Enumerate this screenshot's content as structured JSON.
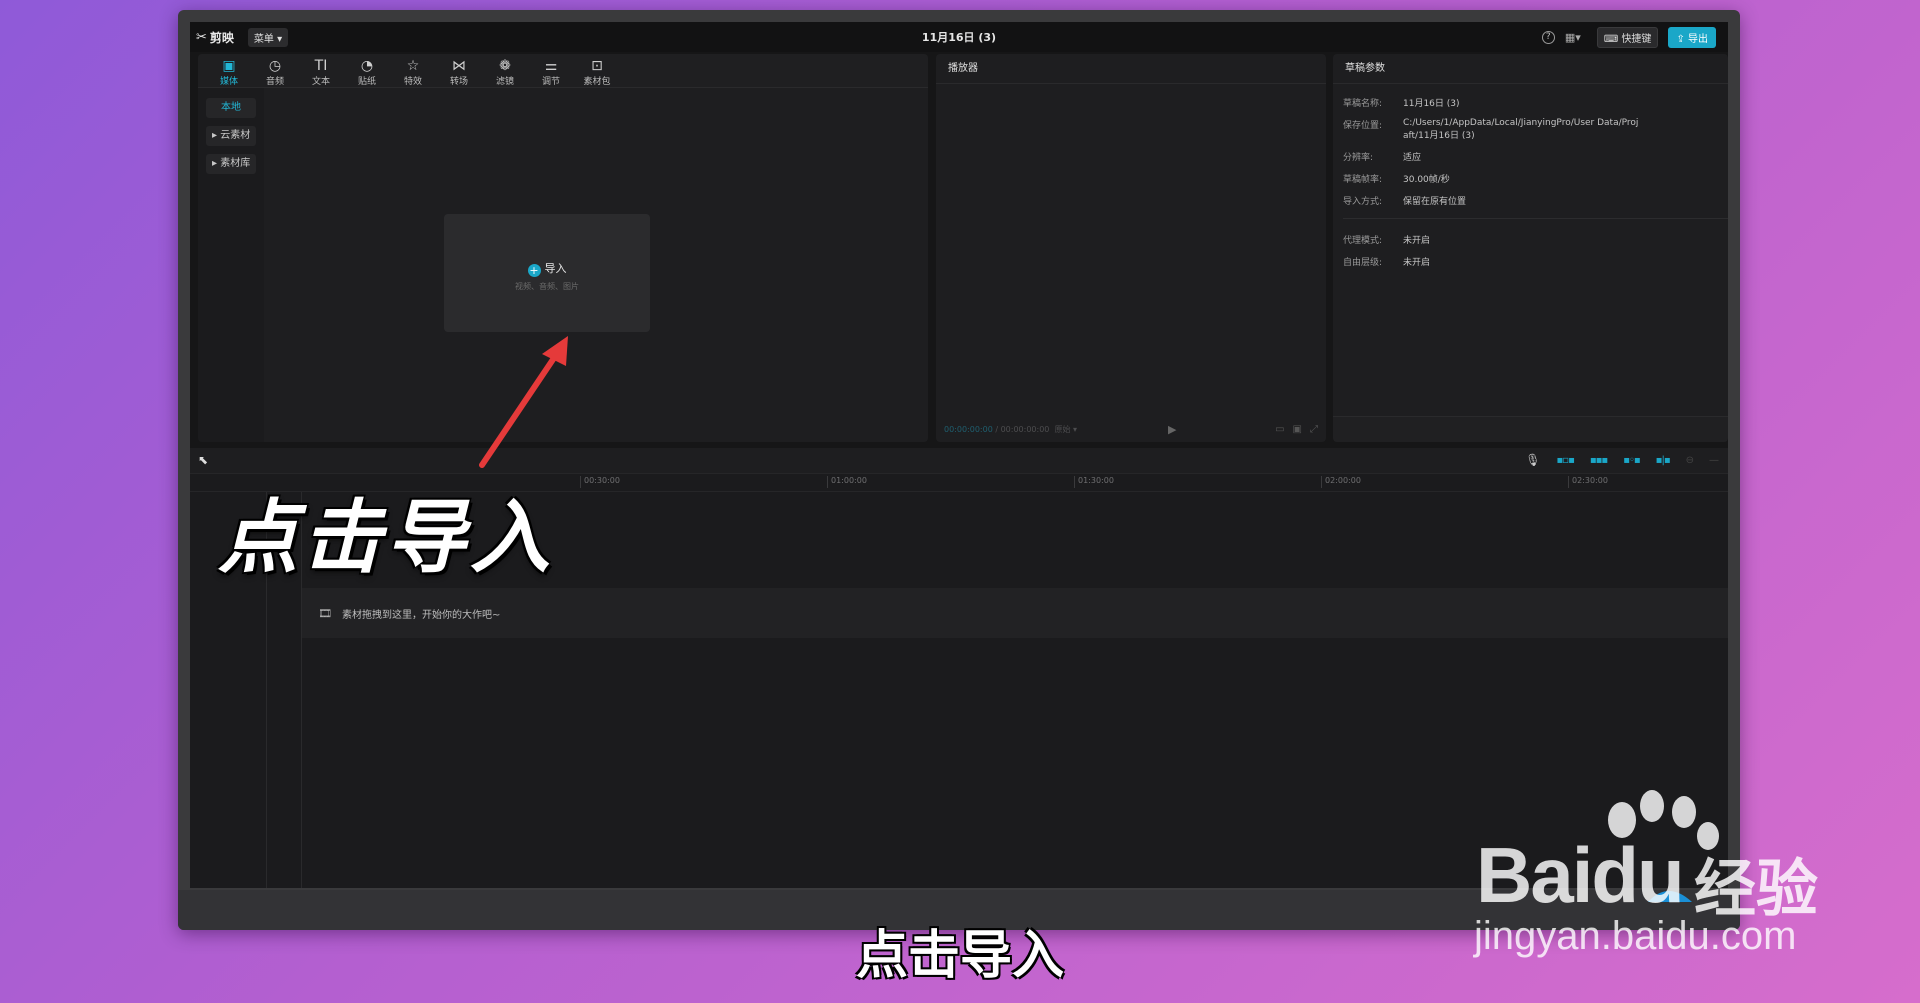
{
  "app": {
    "logo_text": "剪映",
    "menu_label": "菜单",
    "title": "11月16日 (3)",
    "shortcut_label": "快捷键",
    "export_label": "导出",
    "accent_color": "#1aa7c8"
  },
  "media": {
    "tabs": [
      {
        "label": "媒体",
        "icon": "media-icon"
      },
      {
        "label": "音频",
        "icon": "audio-icon"
      },
      {
        "label": "文本",
        "icon": "text-icon"
      },
      {
        "label": "贴纸",
        "icon": "sticker-icon"
      },
      {
        "label": "特效",
        "icon": "effects-icon"
      },
      {
        "label": "转场",
        "icon": "transition-icon"
      },
      {
        "label": "滤镜",
        "icon": "filter-icon"
      },
      {
        "label": "调节",
        "icon": "adjust-icon"
      },
      {
        "label": "素材包",
        "icon": "package-icon"
      }
    ],
    "side_nav": [
      "本地",
      "云素材",
      "素材库"
    ],
    "import_label": "导入",
    "import_hint": "视频、音频、图片"
  },
  "player": {
    "title": "播放器",
    "timecode_current": "00:00:00:00",
    "timecode_total": "00:00:00:00",
    "ratio_label": "原始"
  },
  "props": {
    "title": "草稿参数",
    "rows": [
      {
        "label": "草稿名称:",
        "value": "11月16日 (3)"
      },
      {
        "label": "保存位置:",
        "value": "C:/Users/1/AppData/Local/JianyingPro/User Data/Proj",
        "value2": "aft/11月16日 (3)"
      },
      {
        "label": "分辨率:",
        "value": "适应"
      },
      {
        "label": "草稿帧率:",
        "value": "30.00帧/秒"
      },
      {
        "label": "导入方式:",
        "value": "保留在原有位置"
      },
      {
        "label": "代理模式:",
        "value": "未开启"
      },
      {
        "label": "自由层级:",
        "value": "未开启"
      }
    ]
  },
  "timeline": {
    "ticks": [
      "00:30:00",
      "01:00:00",
      "01:30:00",
      "02:00:00",
      "02:30:00"
    ],
    "drop_hint": "素材拖拽到这里，开始你的大作吧~"
  },
  "overlay": {
    "caption": "点击导入",
    "subtitle": "点击导入"
  },
  "watermark": {
    "brand": "Bai",
    "brand2": "du",
    "cn": "经验",
    "url": "jingyan.baidu.com"
  }
}
